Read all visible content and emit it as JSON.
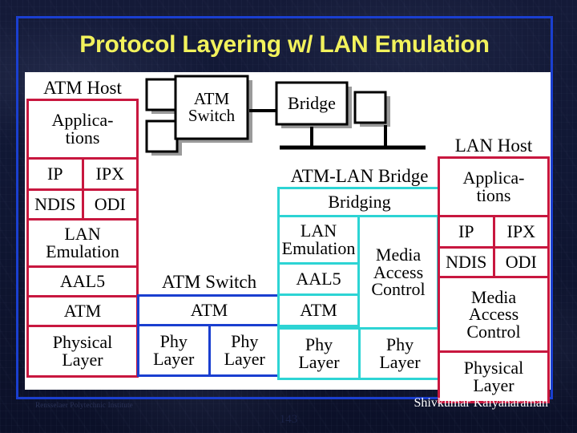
{
  "slide": {
    "title": "Protocol Layering w/ LAN Emulation",
    "accent_blue": "#1a3fd0",
    "title_color": "#f2f25c",
    "panel_background": "#ffffff"
  },
  "topology": {
    "atm_switch_label": "ATM Switch",
    "bridge_label": "Bridge",
    "node_shape": "square-host-box"
  },
  "stacks": [
    {
      "id": "atm-host",
      "title": "ATM Host",
      "border_color": "#c8173f",
      "layers": [
        {
          "label": "Applica-\ntions"
        },
        {
          "split": true,
          "left": "IP",
          "right": "IPX"
        },
        {
          "split": true,
          "left": "NDIS",
          "right": "ODI"
        },
        {
          "label": "LAN\nEmulation"
        },
        {
          "label": "AAL5"
        },
        {
          "label": "ATM"
        },
        {
          "label": "Physical\nLayer"
        }
      ]
    },
    {
      "id": "atm-switch",
      "title": "ATM Switch",
      "border_color": "#1a3fd0",
      "layers": [
        {
          "label": "ATM"
        },
        {
          "split": true,
          "left": "Phy\nLayer",
          "right": "Phy\nLayer"
        }
      ]
    },
    {
      "id": "atm-lan-bridge",
      "title": "ATM-LAN Bridge",
      "border_color": "#2dd4d4",
      "layers": [
        {
          "label": "Bridging"
        },
        {
          "label": "LAN\nEmulation"
        },
        {
          "label": "AAL5"
        },
        {
          "label": "ATM"
        },
        {
          "label": "Media\nAccess\nControl"
        },
        {
          "split": true,
          "left": "Phy\nLayer",
          "right": "Phy\nLayer"
        }
      ]
    },
    {
      "id": "lan-host",
      "title": "LAN Host",
      "border_color": "#c8173f",
      "layers": [
        {
          "label": "Applica-\ntions"
        },
        {
          "split": true,
          "left": "IP",
          "right": "IPX"
        },
        {
          "split": true,
          "left": "NDIS",
          "right": "ODI"
        },
        {
          "label": "Media\nAccess\nControl"
        },
        {
          "label": "Physical\nLayer"
        }
      ]
    }
  ],
  "footer": {
    "institution": "Rensselaer Polytechnic Institute",
    "author": "Shivkumar Kalyanaraman",
    "page_number": "143"
  }
}
